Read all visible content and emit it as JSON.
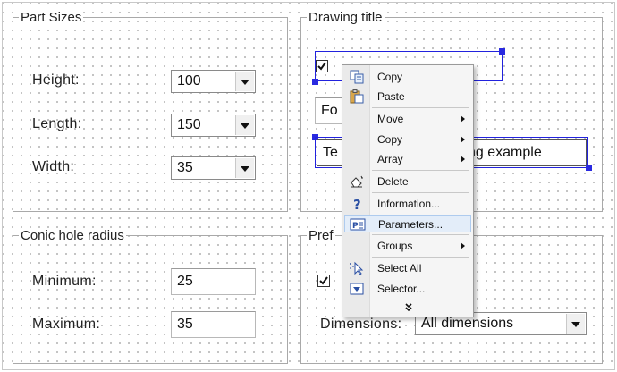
{
  "part_sizes": {
    "title": "Part Sizes",
    "height_label": "Height:",
    "height_value": "100",
    "length_label": "Length:",
    "length_value": "150",
    "width_label": "Width:",
    "width_value": "35"
  },
  "drawing_title": {
    "title": "Drawing title",
    "text_title_partial": "Fo",
    "text_example_start": "Te",
    "text_example_end": "ng example"
  },
  "conic_hole": {
    "title": "Conic hole radius",
    "min_label": "Minimum:",
    "min_value": "25",
    "max_label": "Maximum:",
    "max_value": "35"
  },
  "preferences": {
    "title_partial": "Pref",
    "dimensions_label": "Dimensions:",
    "dimensions_value": "All dimensions"
  },
  "context_menu": {
    "copy": "Copy",
    "paste": "Paste",
    "move": "Move",
    "copy_sub": "Copy",
    "array": "Array",
    "delete": "Delete",
    "information": "Information...",
    "parameters": "Parameters...",
    "groups": "Groups",
    "select_all": "Select All",
    "selector": "Selector..."
  },
  "icons": {
    "copy": "copy-icon",
    "paste": "paste-icon",
    "delete": "eraser-icon",
    "information": "question-icon",
    "parameters": "parameters-icon",
    "select_all": "cursor-select-icon",
    "selector": "dropdown-selector-icon",
    "more": "double-chevron-down-icon"
  },
  "colors": {
    "selection": "#2a2ae0",
    "highlight": "#e3edf9"
  }
}
